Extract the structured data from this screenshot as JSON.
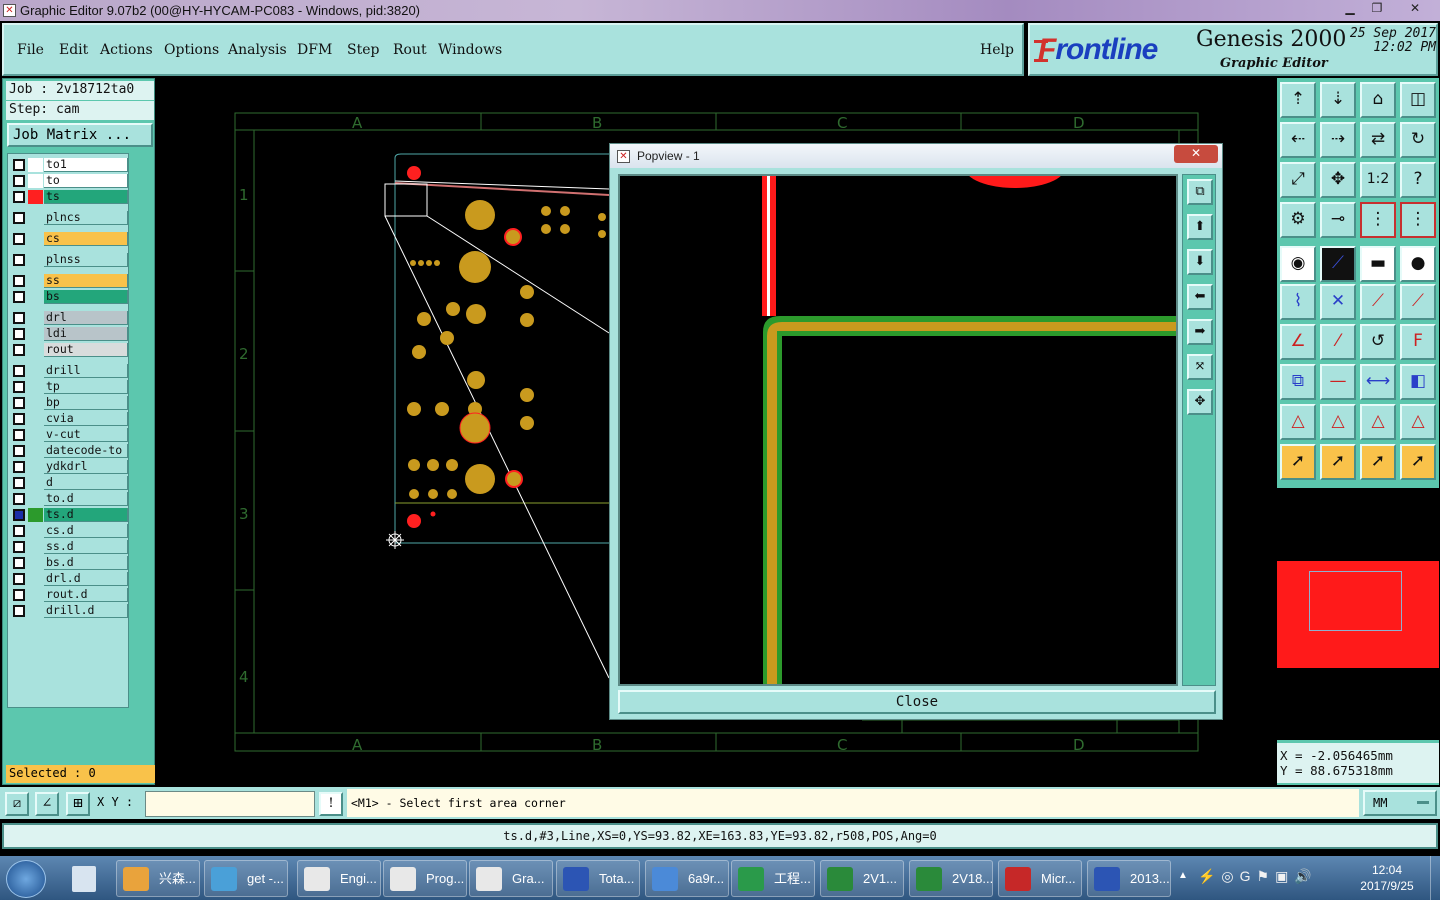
{
  "window": {
    "title": "Graphic Editor 9.07b2 (00@HY-HYCAM-PC083 - Windows, pid:3820)"
  },
  "menu": {
    "items": [
      "File",
      "Edit",
      "Actions",
      "Options",
      "Analysis",
      "DFM",
      "Step",
      "Rout",
      "Windows"
    ],
    "help": "Help"
  },
  "logo": {
    "brand_f": "F",
    "brand_rest": "rontline",
    "product": "Genesis 2000",
    "subtitle": "Graphic Editor",
    "date": "25 Sep 2017",
    "time": "12:02 PM"
  },
  "job": {
    "job_label": "Job : 2v18712ta0",
    "step_label": "Step: cam",
    "matrix_button": "Job Matrix ..."
  },
  "layers": [
    {
      "name": "to1",
      "color": "#ffffff",
      "sw": "#ffffff"
    },
    {
      "name": "to",
      "color": "#ffffff",
      "sw": "#ffffff"
    },
    {
      "name": "ts",
      "color": "#23a67b",
      "sw": "#ff2020"
    },
    {
      "name": "plncs",
      "color": "#a9e2dd",
      "sw": "#a9e2dd"
    },
    {
      "name": "cs",
      "color": "#f9c24a",
      "sw": "#a9e2dd"
    },
    {
      "name": "plnss",
      "color": "#a9e2dd",
      "sw": "#a9e2dd"
    },
    {
      "name": "ss",
      "color": "#f9c24a",
      "sw": "#a9e2dd"
    },
    {
      "name": "bs",
      "color": "#23a67b",
      "sw": "#a9e2dd"
    },
    {
      "name": "drl",
      "color": "#b8c4c9",
      "sw": "#a9e2dd"
    },
    {
      "name": "ldi",
      "color": "#b8c4c9",
      "sw": "#a9e2dd"
    },
    {
      "name": "rout",
      "color": "#d8dcdc",
      "sw": "#a9e2dd"
    },
    {
      "name": "drill",
      "color": "#a9e2dd",
      "sw": "#a9e2dd"
    },
    {
      "name": "tp",
      "color": "#a9e2dd",
      "sw": "#a9e2dd"
    },
    {
      "name": "bp",
      "color": "#a9e2dd",
      "sw": "#a9e2dd"
    },
    {
      "name": "cvia",
      "color": "#a9e2dd",
      "sw": "#a9e2dd"
    },
    {
      "name": "v-cut",
      "color": "#a9e2dd",
      "sw": "#a9e2dd"
    },
    {
      "name": "datecode-to",
      "color": "#a9e2dd",
      "sw": "#a9e2dd"
    },
    {
      "name": "ydkdrl",
      "color": "#a9e2dd",
      "sw": "#a9e2dd"
    },
    {
      "name": "d",
      "color": "#a9e2dd",
      "sw": "#a9e2dd"
    },
    {
      "name": "to.d",
      "color": "#a9e2dd",
      "sw": "#a9e2dd"
    },
    {
      "name": "ts.d",
      "color": "#23a67b",
      "sw": "#2c9a2c"
    },
    {
      "name": "cs.d",
      "color": "#a9e2dd",
      "sw": "#a9e2dd"
    },
    {
      "name": "ss.d",
      "color": "#a9e2dd",
      "sw": "#a9e2dd"
    },
    {
      "name": "bs.d",
      "color": "#a9e2dd",
      "sw": "#a9e2dd"
    },
    {
      "name": "drl.d",
      "color": "#a9e2dd",
      "sw": "#a9e2dd"
    },
    {
      "name": "rout.d",
      "color": "#a9e2dd",
      "sw": "#a9e2dd"
    },
    {
      "name": "drill.d",
      "color": "#a9e2dd",
      "sw": "#a9e2dd"
    }
  ],
  "selected": "Selected : 0",
  "grid": {
    "cols": [
      "A",
      "B",
      "C",
      "D"
    ],
    "rows": [
      "1",
      "2",
      "3",
      "4"
    ]
  },
  "popview": {
    "title": "Popview - 1",
    "close_x": "✕",
    "close_button": "Close"
  },
  "coords": {
    "x": "X = -2.056465mm",
    "y": "Y = 88.675318mm"
  },
  "cmd": {
    "xy_label": "X Y :",
    "xy_value": "",
    "prompt": "<M1> - Select first area corner",
    "unit": "MM"
  },
  "status": "ts.d,#3,Line,XS=0,YS=93.82,XE=163.83,YE=93.82,r508,POS,Ang=0",
  "taskbar": {
    "items": [
      "兴森...",
      "get -...",
      "Engi...",
      "Prog...",
      "Gra...",
      "Tota...",
      "6a9r...",
      "工程...",
      "2V1...",
      "2V18...",
      "Micr...",
      "2013..."
    ],
    "time": "12:04",
    "date": "2017/9/25"
  }
}
